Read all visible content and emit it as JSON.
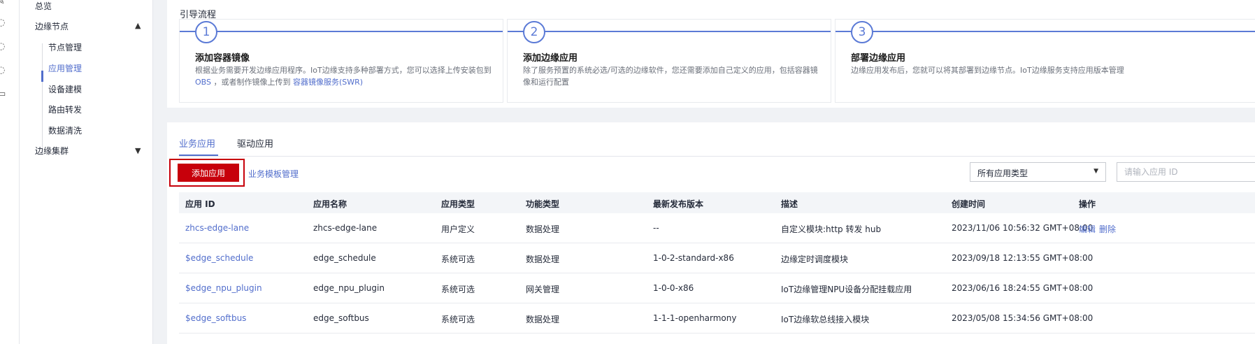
{
  "sidebar": {
    "overview": "总览",
    "edge_nodes": "边缘节点",
    "sub_items": [
      "节点管理",
      "应用管理",
      "设备建模",
      "路由转发",
      "数据清洗"
    ],
    "edge_cluster": "边缘集群"
  },
  "guide": {
    "title": "引导流程",
    "steps": [
      {
        "num": "1",
        "title": "添加容器镜像",
        "desc_a": "根据业务需要开发边缘应用程序。IoT边缘支持多种部署方式，您可以选择上传安装包到",
        "desc_link1": "OBS",
        "desc_b": "，或者制作镜像上传到",
        "desc_link2": "容器镜像服务(SWR)"
      },
      {
        "num": "2",
        "title": "添加边缘应用",
        "desc": "除了服务预置的系统必选/可选的边缘软件，您还需要添加自己定义的应用，包括容器镜像和运行配置"
      },
      {
        "num": "3",
        "title": "部署边缘应用",
        "desc": "边缘应用发布后，您就可以将其部署到边缘节点。IoT边缘服务支持应用版本管理"
      }
    ]
  },
  "tabs": [
    "业务应用",
    "驱动应用"
  ],
  "toolbar": {
    "add_button": "添加应用",
    "template_link": "业务模板管理",
    "type_select": "所有应用类型",
    "search_placeholder": "请输入应用 ID"
  },
  "table": {
    "columns": [
      "应用 ID",
      "应用名称",
      "应用类型",
      "功能类型",
      "最新发布版本",
      "描述",
      "创建时间",
      "操作"
    ],
    "rows": [
      {
        "id": "zhcs-edge-lane",
        "name": "zhcs-edge-lane",
        "type": "用户定义",
        "func": "数据处理",
        "version": "--",
        "desc": "自定义模块:http 转发 hub",
        "created": "2023/11/06 10:56:32 GMT+08:00",
        "op_edit": "编辑",
        "op_delete": "删除"
      },
      {
        "id": "$edge_schedule",
        "name": "edge_schedule",
        "type": "系统可选",
        "func": "数据处理",
        "version": "1-0-2-standard-x86",
        "desc": "边缘定时调度模块",
        "created": "2023/09/18 12:13:55 GMT+08:00",
        "op_edit": "",
        "op_delete": ""
      },
      {
        "id": "$edge_npu_plugin",
        "name": "edge_npu_plugin",
        "type": "系统可选",
        "func": "网关管理",
        "version": "1-0-0-x86",
        "desc": "IoT边缘管理NPU设备分配挂载应用",
        "created": "2023/06/16 18:24:55 GMT+08:00",
        "op_edit": "",
        "op_delete": ""
      },
      {
        "id": "$edge_softbus",
        "name": "edge_softbus",
        "type": "系统可选",
        "func": "数据处理",
        "version": "1-1-1-openharmony",
        "desc": "IoT边缘软总线接入模块",
        "created": "2023/05/08 15:34:56 GMT+08:00",
        "op_edit": "",
        "op_delete": ""
      }
    ]
  }
}
